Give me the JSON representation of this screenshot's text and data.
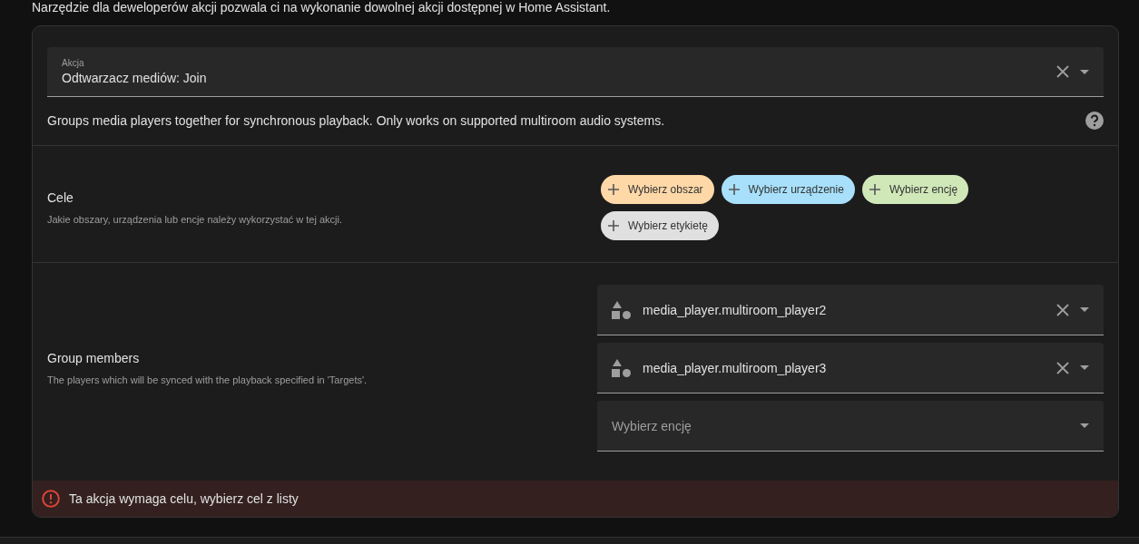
{
  "intro": "Narzędzie dla deweloperów akcji pozwala ci na wykonanie dowolnej akcji dostępnej w Home Assistant.",
  "action": {
    "label": "Akcja",
    "value": "Odtwarzacz mediów: Join"
  },
  "description": "Groups media players together for synchronous playback. Only works on supported multiroom audio systems.",
  "targets": {
    "title": "Cele",
    "subtitle": "Jakie obszary, urządzenia lub encje należy wykorzystać w tej akcji.",
    "chips": [
      {
        "label": "Wybierz obszar",
        "color": "#ffd8a8"
      },
      {
        "label": "Wybierz urządzenie",
        "color": "#a8e0fb"
      },
      {
        "label": "Wybierz encję",
        "color": "#d0e8b8"
      },
      {
        "label": "Wybierz etykietę",
        "color": "#e0e0e0"
      }
    ]
  },
  "group_members": {
    "title": "Group members",
    "subtitle": "The players which will be synced with the playback specified in 'Targets'.",
    "items": [
      {
        "kind": "entity",
        "value": "media_player.multiroom_player2"
      },
      {
        "kind": "entity",
        "value": "media_player.multiroom_player3"
      },
      {
        "kind": "empty",
        "placeholder": "Wybierz encję"
      }
    ]
  },
  "error": "Ta akcja wymaga celu, wybierz cel z listy"
}
